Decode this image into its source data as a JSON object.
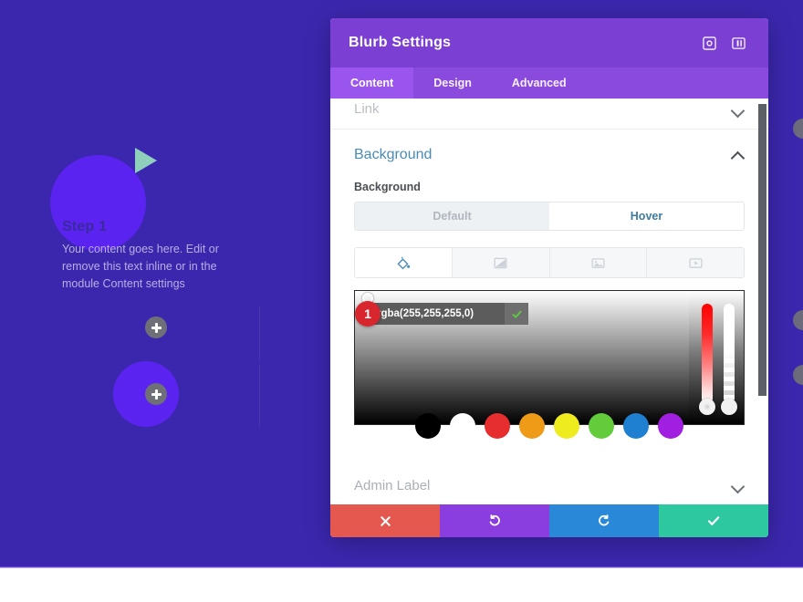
{
  "canvas": {
    "background_color": "#3b27ae",
    "blurb": {
      "title": "Step 1",
      "body": "Your content goes here. Edit or remove this text inline or in the module Content settings",
      "icon": "play-triangle-icon",
      "icon_color": "#8fd0bd",
      "circle_color": "#5a23f0"
    },
    "add_row_label": "+",
    "add_section_label": "+"
  },
  "modal": {
    "title": "Blurb Settings",
    "header_icons": [
      {
        "name": "expand-icon"
      },
      {
        "name": "layout-toggle-icon"
      }
    ],
    "tabs": [
      {
        "label": "Content",
        "active": true
      },
      {
        "label": "Design",
        "active": false
      },
      {
        "label": "Advanced",
        "active": false
      }
    ],
    "sections": {
      "link": {
        "label": "Link",
        "state": "collapsed"
      },
      "background": {
        "label": "Background",
        "state": "open"
      },
      "admin_label": {
        "label": "Admin Label",
        "state": "collapsed"
      }
    },
    "background_panel": {
      "field_label": "Background",
      "state_toggle": [
        {
          "label": "Default",
          "active": false
        },
        {
          "label": "Hover",
          "active": true
        }
      ],
      "type_tabs": [
        {
          "name": "background-color-icon",
          "active": true
        },
        {
          "name": "background-gradient-icon",
          "active": false
        },
        {
          "name": "background-image-icon",
          "active": false
        },
        {
          "name": "background-video-icon",
          "active": false
        }
      ],
      "color_value": "rgba(255,255,255,0)",
      "confirm_icon": "check-icon",
      "step_badge": "1",
      "swatches": [
        "#000000",
        "#ffffff",
        "#e62e2e",
        "#ef9b17",
        "#eeeb1f",
        "#62cc3a",
        "#1f7fd1",
        "#a11fe0"
      ]
    },
    "footer_buttons": [
      {
        "name": "cancel-button",
        "icon": "x-icon",
        "color": "#e4584f"
      },
      {
        "name": "undo-button",
        "icon": "undo-icon",
        "color": "#8b3ee0"
      },
      {
        "name": "redo-button",
        "icon": "redo-icon",
        "color": "#2a88d8"
      },
      {
        "name": "save-button",
        "icon": "check-icon",
        "color": "#2ec8a0"
      }
    ]
  }
}
